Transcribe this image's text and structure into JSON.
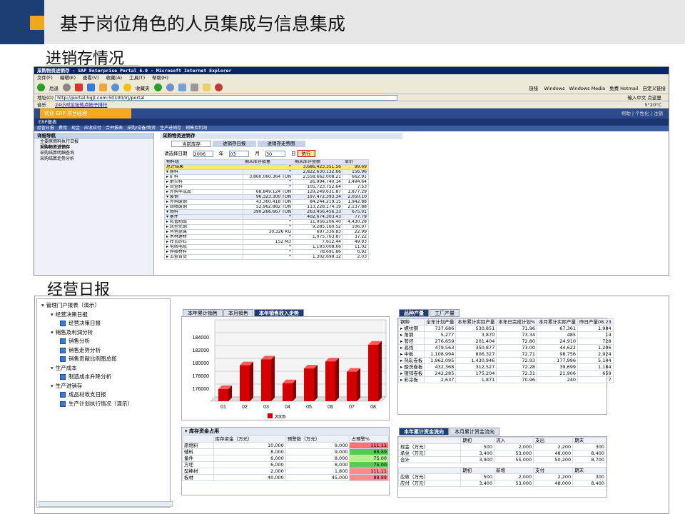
{
  "header": {
    "title": "基于岗位角色的人员集成与信息集成"
  },
  "sections": {
    "s1": "进销存情况",
    "s2": "经营日报"
  },
  "ie": {
    "title": "采购物资进销存 - SAP Enterprise Portal 6.0 - Microsoft Internet Explorer",
    "menu": [
      "文件(F)",
      "编辑(E)",
      "查看(V)",
      "收藏(A)",
      "工具(T)",
      "帮助(H)"
    ],
    "back": "后退",
    "favorites": "收藏夹",
    "links": "链接",
    "link_items": [
      "Windows",
      "Windows Media",
      "免费 Hotmail",
      "自定义链接"
    ],
    "address_label": "地址(D)",
    "address": "http://portal.hgjt.com:50100/irj/portal",
    "music": "音乐",
    "hotlink": "24小时论坛热点帖子排行",
    "input_lang": "输入中文 点这里",
    "zoom": "5°20°C"
  },
  "sap": {
    "welcome": "欢迎 ERP 项目经理",
    "top_links": [
      "帮助",
      "个性化",
      "注销"
    ],
    "nav1": "ERP报表",
    "nav2": [
      "经营日报",
      "费用",
      "现金",
      "应收应付",
      "合并报表",
      "采购/设备/物资",
      "生产进销存",
      "销售及利润"
    ]
  },
  "s1_left": {
    "header": "详细导航",
    "items": [
      "主要原燃料执行日报",
      "采购物资进销存",
      "采购结算明细查询",
      "采购结算走势分析"
    ]
  },
  "s1_main": {
    "title": "采购物资进销存",
    "subtabs": [
      "当前库存",
      "进销存日报",
      "进销存走势图"
    ],
    "date_label": "请选择日期",
    "year": "2006",
    "year_unit": "年",
    "month": "03",
    "month_unit": "月",
    "day": "30",
    "day_unit": "日",
    "exec": "执行",
    "columns": [
      "物料组",
      "期末库存数量",
      "期末库存金额",
      "单价"
    ],
    "rows": [
      {
        "name": "总计结果",
        "qty": "*",
        "amt": "3,686,423,351.56",
        "price": "99.69",
        "hl": true
      },
      {
        "name": "▾ 原料",
        "qty": "*",
        "amt": "2,822,630,132.66",
        "price": "156.96",
        "grp": true
      },
      {
        "name": "▸ 矿料",
        "qty": "3,860,060.364 TON",
        "amt": "2,558,662,008.21",
        "price": "662.91"
      },
      {
        "name": "▸ 耐火料",
        "qty": "*",
        "amt": "26,994,740.14",
        "price": "1,494.64"
      },
      {
        "name": "▸ 合金料",
        "qty": "*",
        "amt": "105,723,752.64",
        "price": "7.53"
      },
      {
        "name": "▸ 外购半成品",
        "qty": "68,849.124 TON",
        "amt": "129,249,631.87",
        "price": "1,877.29"
      },
      {
        "name": "▾ 废钢",
        "qty": "96,323.300 TON",
        "amt": "197,472,393.34",
        "price": "2,050.10",
        "grp": true
      },
      {
        "name": "▸ 外购废钢",
        "qty": "43,360.418 TON",
        "amt": "84,244,219.15",
        "price": "1,942.88"
      },
      {
        "name": "▸ 回收废钢",
        "qty": "52,962.882 TON",
        "amt": "113,228,174.19",
        "price": "2,137.88"
      },
      {
        "name": "▾ 燃料",
        "qty": "390,266.667 TON",
        "amt": "263,456,456.33",
        "price": "675.01",
        "grp": true
      },
      {
        "name": "▾ 备件",
        "qty": "*",
        "amt": "402,674,303.43",
        "price": "77.79",
        "grp": true
      },
      {
        "name": "▸ 轧管制品",
        "qty": "*",
        "amt": "11,056,206.40",
        "price": "4,430.28"
      },
      {
        "name": "▸ 轨型优钢",
        "qty": "*",
        "amt": "9,285,160.52",
        "price": "106.07"
      },
      {
        "name": "▸ 有色金属",
        "qty": "30,326 KG",
        "amt": "697,336.83",
        "price": "22.99"
      },
      {
        "name": "▸ 木材建材",
        "qty": "*",
        "amt": "1,075,763.87",
        "price": "37.22"
      },
      {
        "name": "▸ 砖瓦砂石",
        "qty": "152 M3",
        "amt": "7,612.44",
        "price": "49.93"
      },
      {
        "name": "▸ 电线电缆",
        "qty": "*",
        "amt": "1,193,008.66",
        "price": "11.02"
      },
      {
        "name": "▸ 焊接材料",
        "qty": "*",
        "amt": "78,691.86",
        "price": "6.92"
      },
      {
        "name": "▸ 五金百货",
        "qty": "*",
        "amt": "1,302,699.12",
        "price": "2.03"
      }
    ]
  },
  "s2_left": {
    "items": [
      {
        "t": "管理门户报表（演示）",
        "lvl": 0,
        "type": "tree"
      },
      {
        "t": "经营决策日报",
        "lvl": 1,
        "type": "tree"
      },
      {
        "t": "经营决策日报",
        "lvl": 2,
        "type": "rep"
      },
      {
        "t": "销售及利润分析",
        "lvl": 1,
        "type": "tree"
      },
      {
        "t": "销售分析",
        "lvl": 2,
        "type": "rep"
      },
      {
        "t": "销售走势分析",
        "lvl": 2,
        "type": "rep"
      },
      {
        "t": "销售贡献比例图总揽",
        "lvl": 2,
        "type": "rep"
      },
      {
        "t": "生产成本",
        "lvl": 1,
        "type": "tree"
      },
      {
        "t": "制造成本升降分析",
        "lvl": 2,
        "type": "rep"
      },
      {
        "t": "生产进销存",
        "lvl": 1,
        "type": "tree"
      },
      {
        "t": "成品材收支日报",
        "lvl": 2,
        "type": "rep"
      },
      {
        "t": "生产计划执行情况（演示）",
        "lvl": 2,
        "type": "rep"
      }
    ]
  },
  "s2_tabs": [
    "本年累计销售",
    "本月销售",
    "本年销售收入走势"
  ],
  "chart_data": {
    "type": "bar",
    "categories": [
      "01",
      "02",
      "03",
      "04",
      "05",
      "06",
      "07",
      "08"
    ],
    "series": [
      {
        "name": "2005",
        "values": [
          175900,
          179600,
          180500,
          176800,
          179100,
          180200,
          178600,
          182800
        ]
      }
    ],
    "ylim": [
      174000,
      186000
    ],
    "yticks": [
      "184000",
      "182000",
      "180000",
      "178000",
      "176000"
    ],
    "legend": "bottom",
    "color": "#d40000"
  },
  "prod": {
    "tabs": [
      "品种产量",
      "工厂产量"
    ],
    "columns": [
      "钢种",
      "全年计划产量",
      "本年累计实际产量",
      "本年已完成计划%",
      "本月累计实际产量",
      "昨日产量08.23"
    ],
    "rows": [
      [
        "▸ 螺纹钢",
        "737,686",
        "530,851",
        "71.96",
        "67,361",
        "1,984"
      ],
      [
        "▸ 角钢",
        "5,277",
        "3,870",
        "73.34",
        "485",
        "14"
      ],
      [
        "▸ 管坯",
        "276,659",
        "201,404",
        "72.80",
        "24,910",
        "728"
      ],
      [
        "▸ 高线",
        "479,563",
        "350,877",
        "73.00",
        "44,622",
        "1,206"
      ],
      [
        "▸ 中板",
        "1,108,994",
        "806,327",
        "72.71",
        "98,756",
        "2,924"
      ],
      [
        "▸ 热轧卷板",
        "1,962,095",
        "1,430,946",
        "72.93",
        "177,996",
        "5,144"
      ],
      [
        "▸ 酸洗卷板",
        "432,368",
        "312,527",
        "72.28",
        "39,699",
        "1,184"
      ],
      [
        "▸ 镀锌卷板",
        "242,285",
        "175,204",
        "72.31",
        "21,906",
        "659"
      ],
      [
        "▸ 彩涂板",
        "2,637",
        "1,871",
        "70.96",
        "240",
        "7"
      ]
    ]
  },
  "inv": {
    "title": "▾ 库存资金占用",
    "columns": [
      "",
      "库存资金（万元）",
      "预警数（万元）",
      "占预警%"
    ],
    "rows": [
      [
        "原燃料",
        "10,000",
        "9,000",
        "111.11",
        "r"
      ],
      [
        "辅料",
        "8,000",
        "9,000",
        "88.89",
        "g"
      ],
      [
        "备件",
        "6,000",
        "8,000",
        "75.00",
        "y"
      ],
      [
        "方坯",
        "6,000",
        "8,000",
        "75.00",
        "g"
      ],
      [
        "型棒材",
        "2,000",
        "1,800",
        "111.11",
        "m"
      ],
      [
        "板材",
        "40,000",
        "45,000",
        "88.89",
        "m"
      ]
    ]
  },
  "cash": {
    "tabs": [
      "本年累计资金流向",
      "本月累计资金流向"
    ],
    "col1": [
      "",
      "期初",
      "流入",
      "支出",
      "期末"
    ],
    "rows1": [
      [
        "现金（万元）",
        "500",
        "2,000",
        "2,200",
        "300"
      ],
      [
        "承兑（万元）",
        "3,400",
        "53,000",
        "48,000",
        "8,400"
      ],
      [
        "合计",
        "3,900",
        "55,000",
        "50,200",
        "8,700"
      ]
    ],
    "col2": [
      "",
      "期初",
      "新增",
      "支付",
      "期末"
    ],
    "rows2": [
      [
        "应收（万元）",
        "500",
        "2,000",
        "2,200",
        "300"
      ],
      [
        "应付（万元）",
        "3,400",
        "53,000",
        "48,000",
        "8,400"
      ]
    ]
  }
}
